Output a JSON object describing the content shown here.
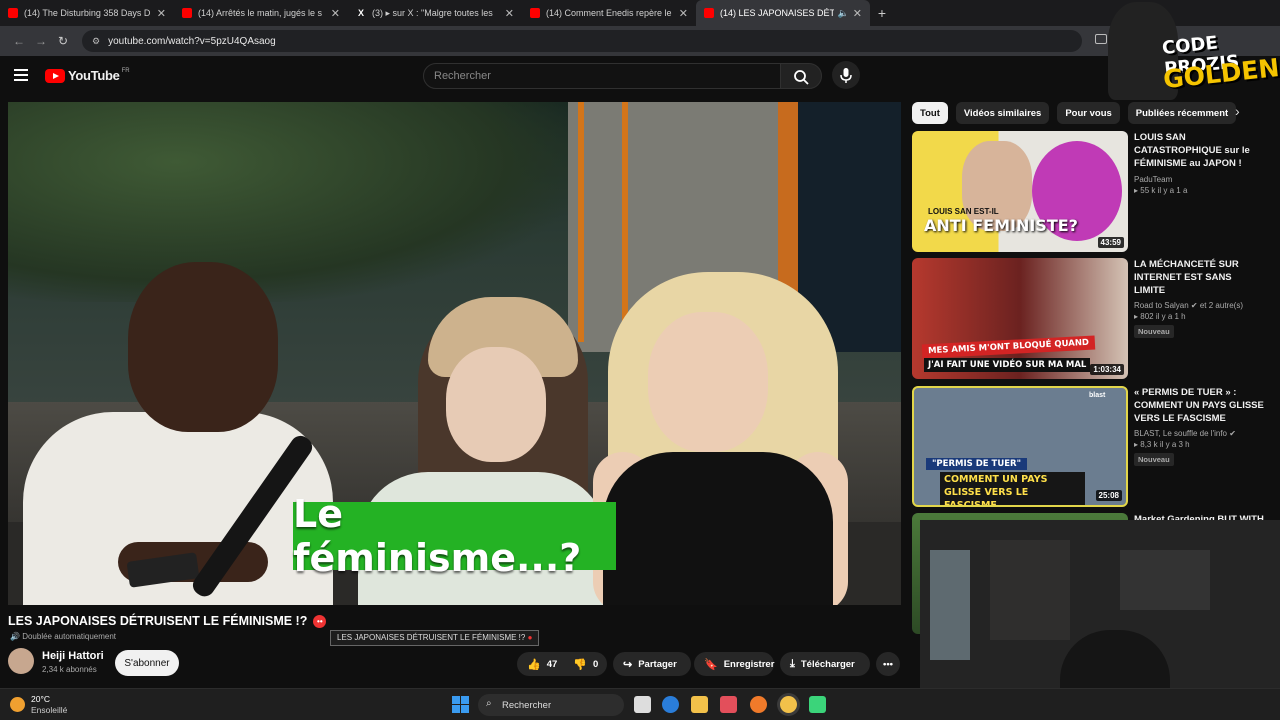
{
  "browser": {
    "tabs": [
      {
        "title": "(14) The Disturbing 358 Days D",
        "icon": "youtube-icon"
      },
      {
        "title": "(14) Arrêtés le matin, jugés le s",
        "icon": "youtube-icon"
      },
      {
        "title": "(3) ▸ sur X : \"Malgre toutes les",
        "icon": "x-icon"
      },
      {
        "title": "(14) Comment Enedis repère le",
        "icon": "youtube-icon"
      },
      {
        "title": "(14) LES JAPONAISES DÉTRUI",
        "icon": "youtube-icon",
        "active": true
      }
    ],
    "url": "youtube.com/watch?v=5pzU4QAsaog"
  },
  "youtube": {
    "logo_text": "YouTube",
    "country_code": "FR",
    "search_placeholder": "Rechercher"
  },
  "video": {
    "subtitle": "Le féminisme...?",
    "title": "LES JAPONAISES DÉTRUISENT LE FÉMINISME !?",
    "dub_label": "Doublée automatiquement",
    "tooltip": "LES JAPONAISES DÉTRUISENT LE FÉMINISME !?",
    "channel": "Heiji Hattori",
    "subscribers": "2,34 k abonnés",
    "subscribe_label": "S'abonner",
    "likes": "47",
    "dislikes": "0",
    "share_label": "Partager",
    "save_label": "Enregistrer",
    "download_label": "Télécharger"
  },
  "sidebar": {
    "chips": [
      "Tout",
      "Vidéos similaires",
      "Pour vous",
      "Publiées récemment"
    ],
    "recommendations": [
      {
        "title": "LOUIS SAN CATASTROPHIQUE sur le FÉMINISME au JAPON ! (av...",
        "channel": "PaduTeam",
        "meta": "55 k  il y a 1 a",
        "duration": "43:59",
        "thumb_text": "ANTI FEMINISTE?",
        "thumb_text2": "LOUIS SAN EST-IL"
      },
      {
        "title": "LA MÉCHANCETÉ SUR INTERNET EST SANS LIMITE",
        "channel": "Road to Salyan ✔ et 2 autre(s)",
        "meta": "802  il y a 1 h",
        "badge": "Nouveau",
        "duration": "1:03:34",
        "thumb_text": "MES AMIS M'ONT BLOQUÉ QUAND",
        "thumb_text2": "J'AI FAIT UNE VIDÉO SUR MA MAL"
      },
      {
        "title": "« PERMIS DE TUER » : COMMENT UN PAYS GLISSE VERS LE FASCISME",
        "channel": "BLAST, Le souffle de l'info ✔",
        "meta": "8,3 k  il y a 3 h",
        "badge": "Nouveau",
        "duration": "25:08",
        "thumb_text": "\"PERMIS DE TUER\"",
        "thumb_text2": "COMMENT UN PAYS GLISSE VERS LE FASCISME",
        "thumb_text3": "blast"
      },
      {
        "title": "Market Gardening BUT WITH",
        "channel": "",
        "meta": ""
      }
    ]
  },
  "overlay": {
    "brand_line1": "CODE PROZIS",
    "brand_line2": "GOLDENG"
  },
  "taskbar": {
    "temperature": "20°C",
    "condition": "Ensoleillé",
    "search_label": "Rechercher"
  }
}
